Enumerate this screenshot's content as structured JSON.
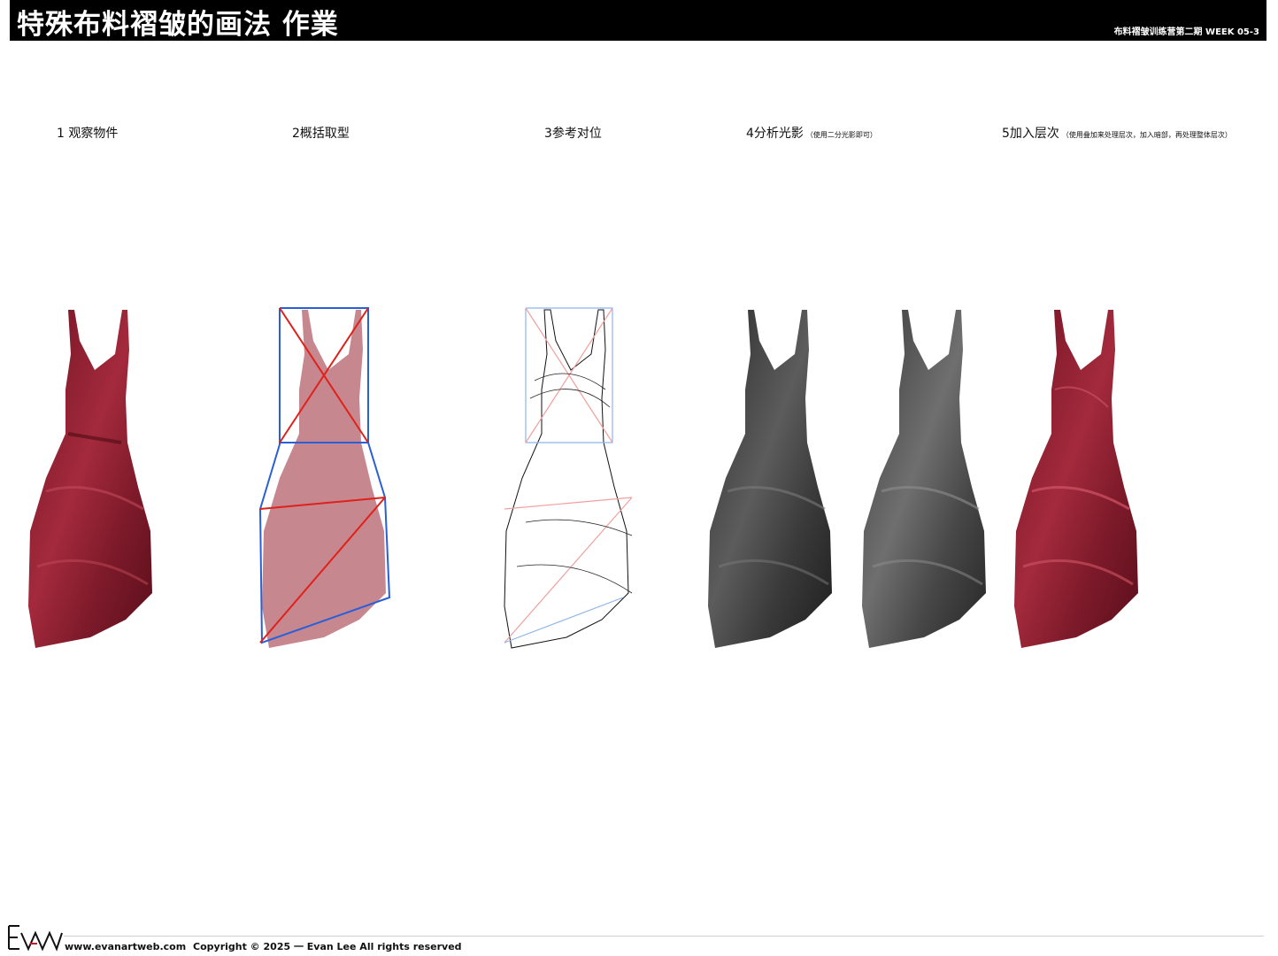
{
  "header": {
    "title": "特殊布料褶皱的画法 作業",
    "subtitle": "布料褶皱训练营第二期 WEEK 05-3"
  },
  "steps": [
    {
      "label": "1 观察物件",
      "note": ""
    },
    {
      "label": "2概括取型",
      "note": ""
    },
    {
      "label": "3参考对位",
      "note": ""
    },
    {
      "label": "4分析光影",
      "note": "（使用二分光影即可）"
    },
    {
      "label": "5加入层次",
      "note": "（使用叠加来处理层次，加入暗部，再处理整体层次）"
    }
  ],
  "footer": {
    "logo_text": "EvW",
    "website": "www.evanartweb.com",
    "copyright": "Copyright © 2025 一  Evan Lee  All rights reserved"
  },
  "colors": {
    "header_bg": "#000000",
    "dress_red": "#8a1e2e",
    "dress_gray": "#3a3a3a",
    "guide_red": "#e0201a",
    "guide_blue": "#2a5fd8"
  }
}
